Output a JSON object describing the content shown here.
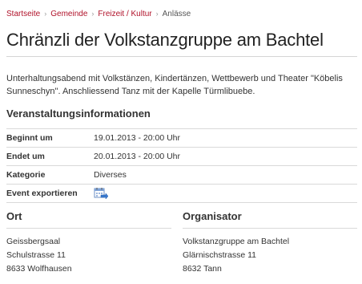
{
  "breadcrumb": {
    "items": [
      "Startseite",
      "Gemeinde",
      "Freizeit / Kultur"
    ],
    "current": "Anlässe",
    "separator": "›"
  },
  "event": {
    "title": "Chränzli der Volkstanzgruppe am Bachtel",
    "description": "Unterhaltungsabend mit Volkstänzen, Kindertänzen, Wettbewerb und Theater \"Köbelis Sunneschyn\". Anschliessend Tanz mit der Kapelle Türmlibuebe."
  },
  "info": {
    "heading": "Veranstaltungsinformationen",
    "rows": [
      {
        "label": "Beginnt um",
        "value": "19.01.2013 - 20:00 Uhr"
      },
      {
        "label": "Endet um",
        "value": "20.01.2013 - 20:00 Uhr"
      },
      {
        "label": "Kategorie",
        "value": "Diverses"
      }
    ],
    "export_label": "Event exportieren",
    "export_icon": "calendar-export-icon"
  },
  "location": {
    "heading": "Ort",
    "lines": [
      "Geissbergsaal",
      "Schulstrasse 11",
      "8633 Wolfhausen"
    ]
  },
  "organizer": {
    "heading": "Organisator",
    "lines": [
      "Volkstanzgruppe am Bachtel",
      "Glärnischstrasse 11",
      "8632 Tann"
    ]
  },
  "colors": {
    "link": "#b0122a",
    "rule": "#d9d9d9",
    "text": "#222222"
  }
}
